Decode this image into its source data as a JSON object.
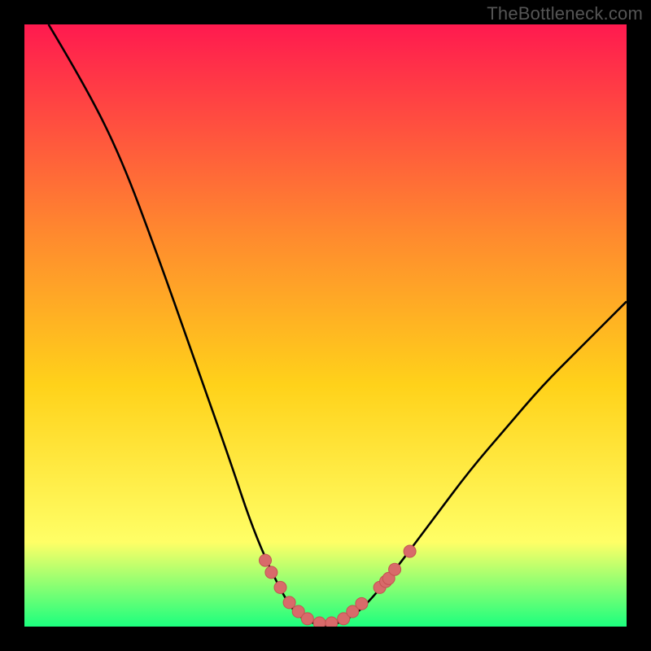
{
  "brand": "TheBottleneck.com",
  "colors": {
    "bg_black": "#000000",
    "grad_top": "#ff1a4f",
    "grad_mid1": "#ff8a2e",
    "grad_mid2": "#ffd21a",
    "grad_mid3": "#ffff66",
    "grad_bottom": "#1cff7e",
    "curve": "#000000",
    "marker_fill": "#d86a6a",
    "marker_stroke": "#c45252"
  },
  "chart_data": {
    "type": "line",
    "title": "",
    "xlabel": "",
    "ylabel": "",
    "xlim": [
      0,
      100
    ],
    "ylim": [
      0,
      100
    ],
    "curve": [
      {
        "x": 4,
        "y": 100
      },
      {
        "x": 10,
        "y": 90
      },
      {
        "x": 16,
        "y": 78
      },
      {
        "x": 22,
        "y": 62
      },
      {
        "x": 28,
        "y": 45
      },
      {
        "x": 34,
        "y": 28
      },
      {
        "x": 38,
        "y": 16
      },
      {
        "x": 42,
        "y": 7
      },
      {
        "x": 45,
        "y": 2
      },
      {
        "x": 48,
        "y": 0.5
      },
      {
        "x": 50,
        "y": 0
      },
      {
        "x": 52,
        "y": 0.5
      },
      {
        "x": 55,
        "y": 2
      },
      {
        "x": 58,
        "y": 5
      },
      {
        "x": 62,
        "y": 10
      },
      {
        "x": 68,
        "y": 18
      },
      {
        "x": 74,
        "y": 26
      },
      {
        "x": 80,
        "y": 33
      },
      {
        "x": 86,
        "y": 40
      },
      {
        "x": 92,
        "y": 46
      },
      {
        "x": 100,
        "y": 54
      }
    ],
    "markers": [
      {
        "x": 40,
        "y": 11
      },
      {
        "x": 41,
        "y": 9
      },
      {
        "x": 42.5,
        "y": 6.5
      },
      {
        "x": 44,
        "y": 4
      },
      {
        "x": 45.5,
        "y": 2.5
      },
      {
        "x": 47,
        "y": 1.3
      },
      {
        "x": 49,
        "y": 0.6
      },
      {
        "x": 51,
        "y": 0.6
      },
      {
        "x": 53,
        "y": 1.3
      },
      {
        "x": 54.5,
        "y": 2.5
      },
      {
        "x": 56,
        "y": 3.8
      },
      {
        "x": 59,
        "y": 6.5
      },
      {
        "x": 60,
        "y": 7.5
      },
      {
        "x": 60.5,
        "y": 8
      },
      {
        "x": 61.5,
        "y": 9.5
      },
      {
        "x": 64,
        "y": 12.5
      }
    ]
  }
}
